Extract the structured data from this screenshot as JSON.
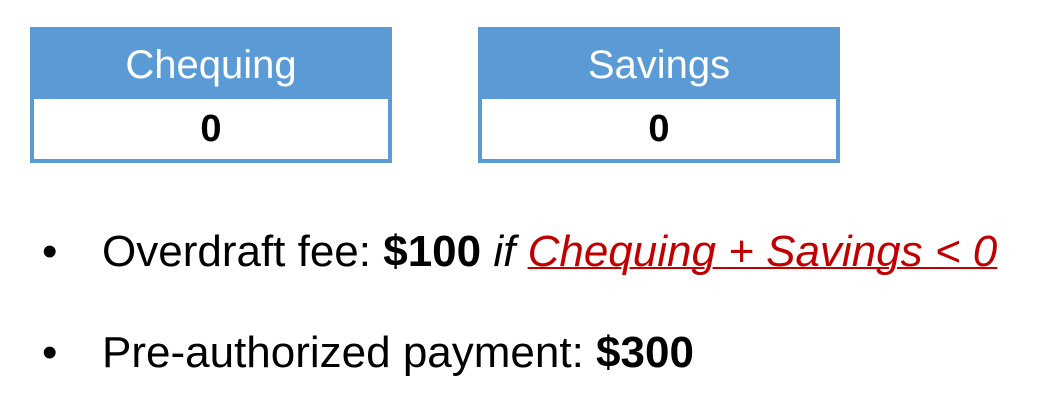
{
  "accounts": {
    "chequing": {
      "label": "Chequing",
      "value": "0"
    },
    "savings": {
      "label": "Savings",
      "value": "0"
    }
  },
  "bullets": {
    "marker": "•",
    "overdraft": {
      "label": "Overdraft fee: ",
      "amount": "$100",
      "connector": " if ",
      "condition": "Chequing + Savings < 0"
    },
    "payment": {
      "label": "Pre-authorized payment: ",
      "amount": "$300"
    }
  },
  "colors": {
    "account_header": "#5b9bd5",
    "condition_text": "#c00000"
  }
}
